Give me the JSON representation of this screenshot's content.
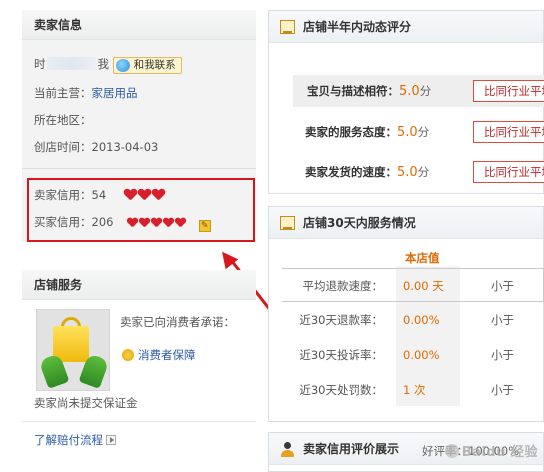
{
  "seller_info": {
    "title": "卖家信息",
    "name_prefix": "时",
    "name_suffix": "我",
    "contact_label": "和我联系",
    "main_category_label": "当前主营：",
    "main_category_value": "家居用品",
    "location_label": "所在地区：",
    "location_value": "",
    "created_label": "创店时间：",
    "created_value": "2013-04-03",
    "seller_credit_label": "卖家信用：",
    "seller_credit_value": "54",
    "seller_hearts": 3,
    "buyer_credit_label": "买家信用：",
    "buyer_credit_value": "206",
    "buyer_hearts": 5
  },
  "store_service": {
    "title": "店铺服务",
    "promise_text": "卖家已向消费者承诺：",
    "protection_label": "消费者保障",
    "deposit_text": "卖家尚未提交保证金",
    "claim_link": "了解赔付流程"
  },
  "ratings_panel": {
    "title": "店铺半年内动态评分",
    "rows": [
      {
        "label": "宝贝与描述相符：",
        "score": "5.0",
        "unit": "分",
        "compare": "比同行业平均"
      },
      {
        "label": "卖家的服务态度：",
        "score": "5.0",
        "unit": "分",
        "compare": "比同行业平均"
      },
      {
        "label": "卖家发货的速度：",
        "score": "5.0",
        "unit": "分",
        "compare": "比同行业平均"
      }
    ]
  },
  "service_panel": {
    "title": "店铺30天内服务情况",
    "store_col": "本店值",
    "rows": [
      {
        "label": "平均退款速度：",
        "value": "0.00 天",
        "compare": "小于"
      },
      {
        "label": "近30天退款率：",
        "value": "0.00%",
        "compare": "小于"
      },
      {
        "label": "近30天投诉率：",
        "value": "0.00%",
        "compare": "小于"
      },
      {
        "label": "近30天处罚数：",
        "value": "1 次",
        "compare": "小于"
      }
    ]
  },
  "credit_panel": {
    "title": "卖家信用评价展示",
    "good_rate": "好评率：100.00%"
  },
  "watermark": "Baidu 经验",
  "colors": {
    "accent": "#e06a00",
    "highlight_border": "#d9161b",
    "link": "#2b5aa8"
  }
}
